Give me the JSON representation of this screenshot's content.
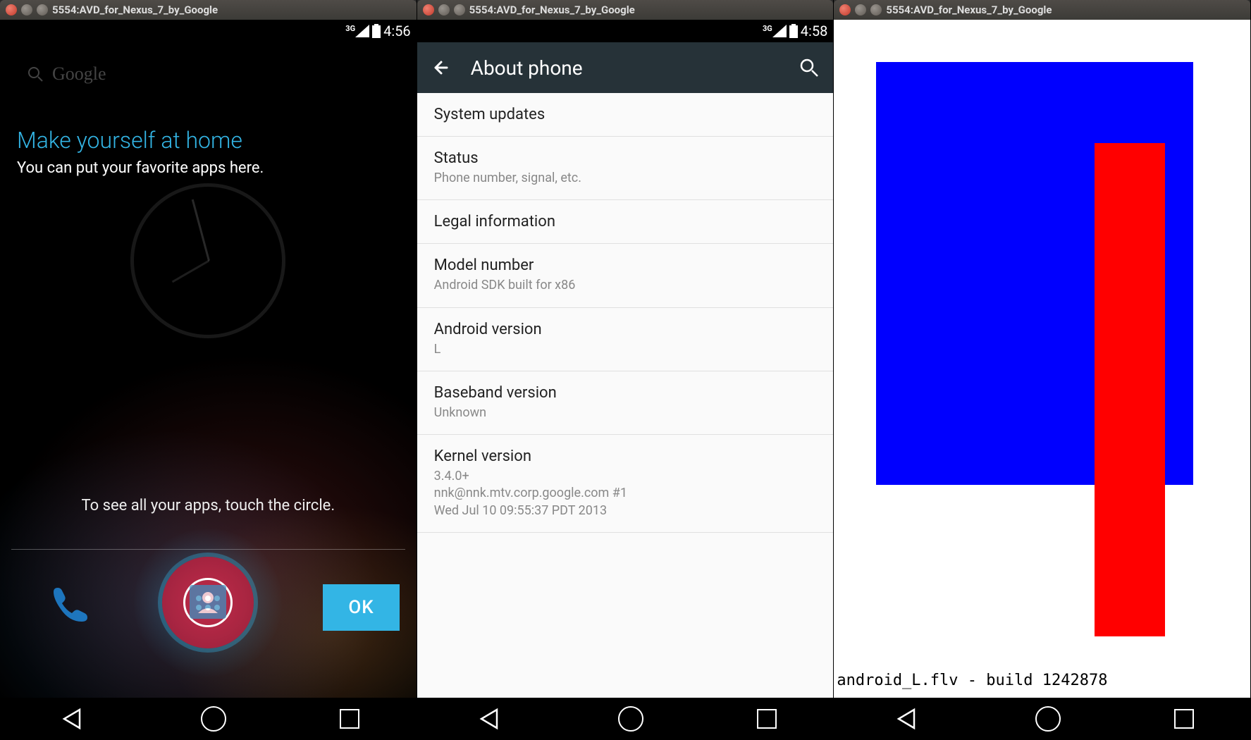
{
  "window_title": "5554:AVD_for_Nexus_7_by_Google",
  "home": {
    "status_time": "4:56",
    "status_net": "3G",
    "search_placeholder": "Google",
    "welcome_title": "Make yourself at home",
    "welcome_sub": "You can put your favorite apps here.",
    "hint": "To see all your apps, touch the circle.",
    "ok": "OK"
  },
  "about": {
    "status_time": "4:58",
    "status_net": "3G",
    "title": "About phone",
    "items": [
      {
        "primary": "System updates",
        "secondary": ""
      },
      {
        "primary": "Status",
        "secondary": "Phone number, signal, etc."
      },
      {
        "primary": "Legal information",
        "secondary": ""
      },
      {
        "primary": "Model number",
        "secondary": "Android SDK built for x86"
      },
      {
        "primary": "Android version",
        "secondary": "L"
      },
      {
        "primary": "Baseband version",
        "secondary": "Unknown"
      },
      {
        "primary": "Kernel version",
        "secondary": "3.4.0+\nnnk@nnk.mtv.corp.google.com #1\nWed Jul 10 09:55:37 PDT 2013"
      }
    ]
  },
  "rgb": {
    "caption": "android_L.flv - build 1242878"
  }
}
